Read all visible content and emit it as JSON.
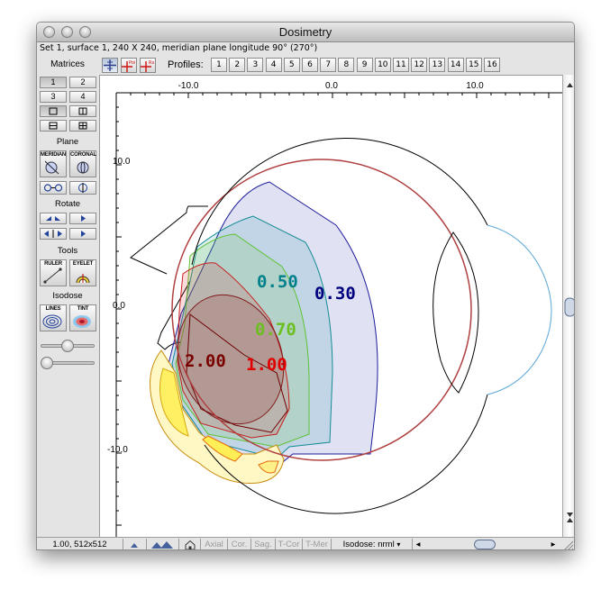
{
  "window": {
    "title": "Dosimetry"
  },
  "info_line": "Set 1, surface 1, 240 X 240, meridian plane longitude 90° (270°)",
  "toolbar": {
    "view_buttons": [
      {
        "icon": "crosshair-icon"
      },
      {
        "icon": "poi-icon",
        "label": "Poi"
      },
      {
        "icon": "rx-icon",
        "label": "Rx"
      }
    ],
    "profiles_label": "Profiles:",
    "profiles": [
      "1",
      "2",
      "3",
      "4",
      "5",
      "6",
      "7",
      "8",
      "9",
      "10",
      "11",
      "12",
      "13",
      "14",
      "15",
      "16"
    ]
  },
  "sidebar": {
    "matrices_label": "Matrices",
    "matrix_buttons": [
      "1",
      "2",
      "3",
      "4"
    ],
    "plane_label": "Plane",
    "plane_buttons": [
      "MERIDIAN",
      "CORONAL"
    ],
    "rotate_label": "Rotate",
    "tools_label": "Tools",
    "tool_buttons": [
      "RULER",
      "EYELET"
    ],
    "isodose_label": "Isodose",
    "isodose_buttons": [
      "LINES",
      "TINT"
    ]
  },
  "plot": {
    "x_ticks": [
      "-10.0",
      "0.0",
      "10.0"
    ],
    "y_ticks": [
      "10.0",
      "0.0",
      "-10.0"
    ],
    "isodose_labels": [
      {
        "text": "0.50",
        "color": "#00808a"
      },
      {
        "text": "0.30",
        "color": "#00007f"
      },
      {
        "text": "0.70",
        "color": "#6cbf1f"
      },
      {
        "text": "2.00",
        "color": "#7a0000"
      },
      {
        "text": "1.00",
        "color": "#e00000"
      }
    ],
    "contour_colors": {
      "c030": "#1c1c9a",
      "c050": "#138c92",
      "c070": "#5ec233",
      "c100": "#c81e1e",
      "c200": "#801a1a",
      "sclera": "#b04040",
      "cornea": "#5aa6d6"
    }
  },
  "statusbar": {
    "coords": "1.00, 512x512",
    "views": [
      "Axial",
      "Cor.",
      "Sag.",
      "T-Cor",
      "T-Mer"
    ],
    "isodose": "Isodose: nrml"
  }
}
